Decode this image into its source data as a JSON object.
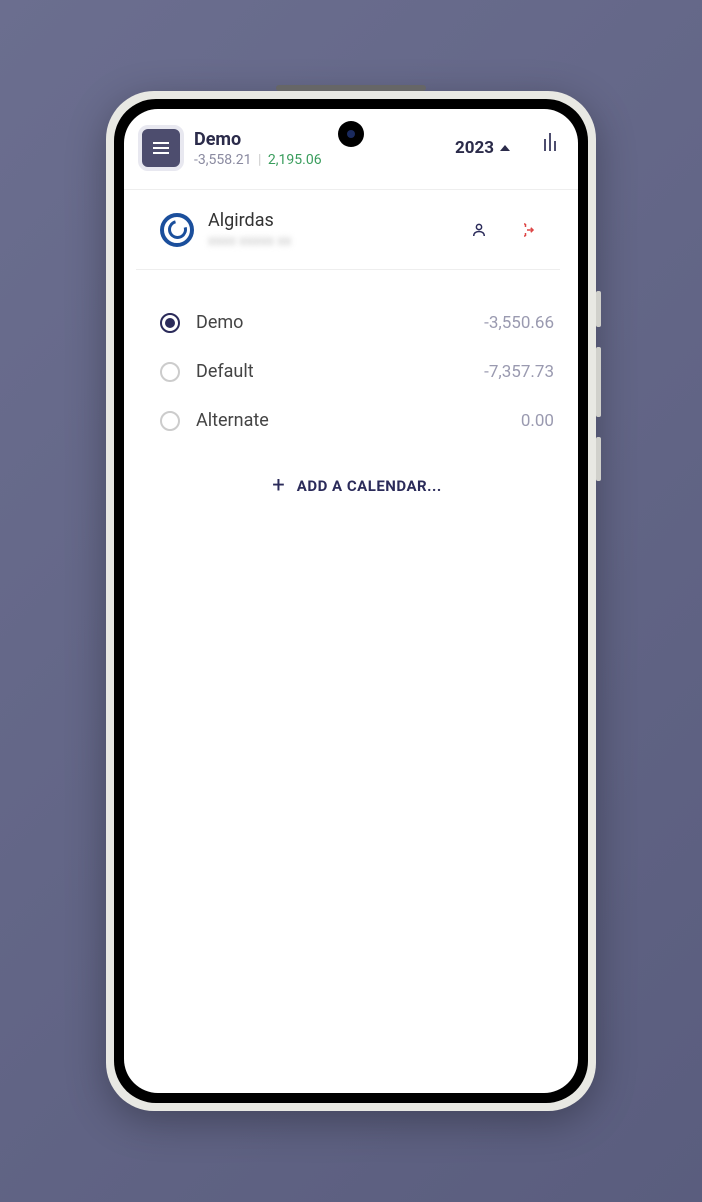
{
  "header": {
    "title": "Demo",
    "balance_neg": "-3,558.21",
    "balance_pos": "2,195.06",
    "year": "2023"
  },
  "profile": {
    "name": "Algirdas",
    "email_obscured": "xxxx xxxxx xx"
  },
  "calendars": [
    {
      "name": "Demo",
      "balance": "-3,550.66",
      "selected": true
    },
    {
      "name": "Default",
      "balance": "-7,357.73",
      "selected": false
    },
    {
      "name": "Alternate",
      "balance": "0.00",
      "selected": false
    }
  ],
  "add_label": "ADD A CALENDAR..."
}
